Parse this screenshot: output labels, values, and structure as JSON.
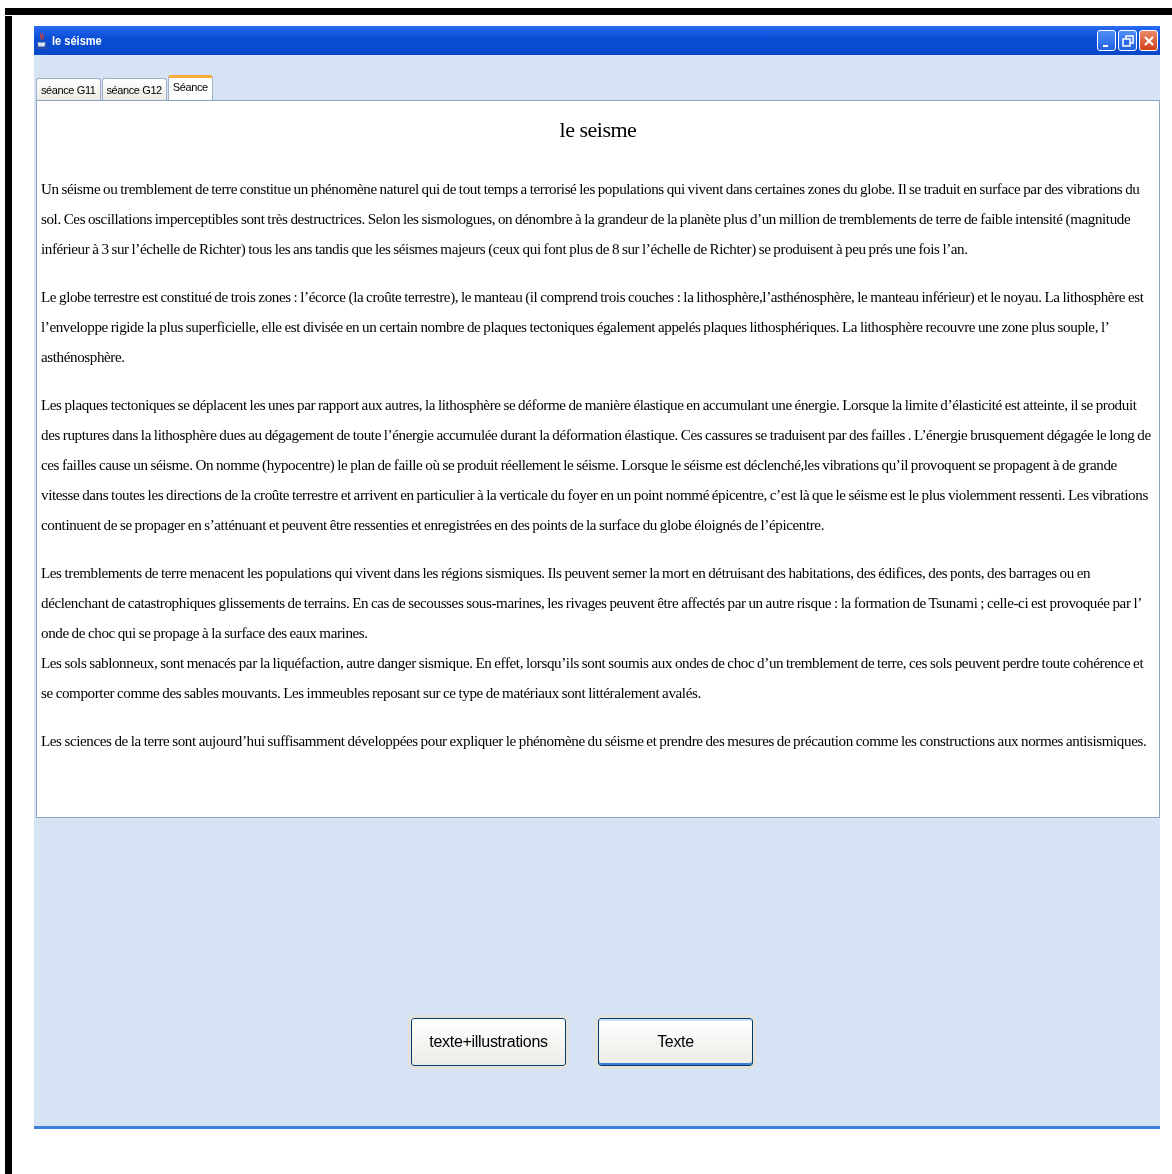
{
  "window": {
    "title": "le séisme"
  },
  "tabs": [
    {
      "label": "séance G11",
      "selected": false
    },
    {
      "label": "séance G12",
      "selected": false
    },
    {
      "label": "Séance",
      "selected": true
    }
  ],
  "document": {
    "heading": "le seisme",
    "paragraphs": [
      {
        "texts": [
          "Un séisme ou tremblement de terre constitue un phénomène naturel qui de tout temps a terrorisé les populations qui vivent dans certaines zones du globe. Il se traduit en surface par des vibrations du sol. Ces oscillations imperceptibles sont très destructrices. Selon les sismologues, on dénombre à la grandeur de la planète plus d’un million de tremblements de terre de faible intensité (magnitude inférieur à 3 sur l’échelle de Richter) tous les ans tandis que les séismes majeurs (ceux qui font plus de 8 sur l’échelle de Richter) se produisent à peu prés une fois l’an."
        ]
      },
      {
        "texts": [
          "Le globe terrestre est constitué de trois zones : l’écorce (la croûte terrestre), le manteau (il comprend trois couches : la lithosphère,l’asthénosphère, le manteau inférieur) et le noyau. La lithosphère est l’enveloppe rigide la plus superficielle, elle est divisée en un certain nombre de plaques tectoniques également appelés plaques lithosphériques. La lithosphère recouvre une zone plus souple, l’ asthénosphère."
        ]
      },
      {
        "texts": [
          "Les plaques tectoniques se déplacent les unes par rapport aux autres, la lithosphère se déforme de manière élastique en accumulant une énergie. Lorsque la limite d’élasticité est atteinte, il se produit des ruptures dans la lithosphère dues au dégagement de toute l’énergie accumulée durant la déformation élastique. Ces cassures se traduisent par des failles . L’énergie brusquement dégagée le long de ces failles cause un séisme. On nomme (hypocentre) le plan de faille où se produit réellement le séisme. Lorsque le séisme est déclenché,les vibrations qu’il provoquent se propagent à de grande vitesse dans toutes les directions de la croûte terrestre et arrivent en particulier à la verticale du foyer en un point nommé épicentre, c’est là que le séisme est le plus violemment ressenti. Les vibrations continuent de se propager en s’atténuant et peuvent être ressenties et enregistrées en des points de la surface du globe éloignés de l’épicentre."
        ]
      },
      {
        "texts": [
          "Les tremblements de terre menacent les populations qui vivent dans les régions sismiques. Ils peuvent semer la mort en détruisant des habitations, des édifices, des ponts, des barrages ou en déclenchant de catastrophiques glissements de terrains. En cas de secousses sous-marines, les rivages peuvent être affectés par un autre risque : la formation de Tsunami ; celle-ci est provoquée par l’ onde de choc qui se propage à la surface des eaux marines.",
          "Les sols sablonneux, sont menacés par la liquéfaction, autre danger sismique. En effet, lorsqu’ils sont soumis aux ondes de choc d’un tremblement de terre, ces sols peuvent perdre toute cohérence et se comporter comme des sables mouvants. Les immeubles reposant sur ce type de matériaux sont littéralement avalés."
        ]
      },
      {
        "texts": [
          "Les sciences de la terre sont aujourd’hui suffisamment développées pour expliquer le phénomène du séisme et prendre des mesures de précaution comme les constructions aux normes antisismiques."
        ]
      }
    ]
  },
  "buttons": [
    {
      "label": "texte+illustrations",
      "focused": false
    },
    {
      "label": "Texte",
      "focused": true
    }
  ]
}
